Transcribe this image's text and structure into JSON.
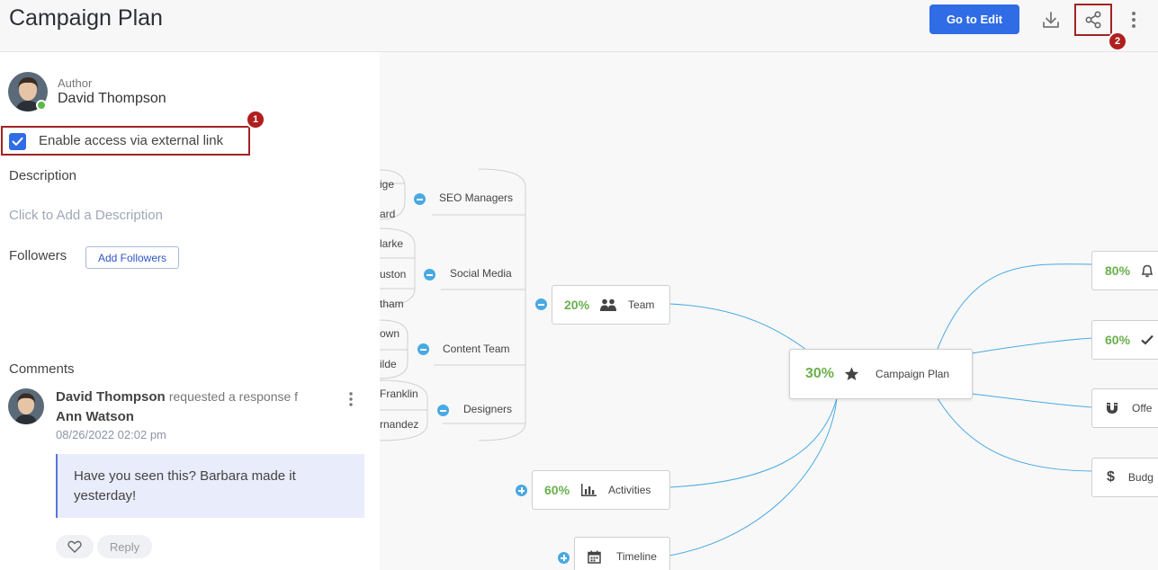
{
  "header": {
    "title": "Campaign Plan",
    "edit_button": "Go to Edit",
    "share_marker": "2"
  },
  "left": {
    "author_label": "Author",
    "author_name": "David Thompson",
    "access_label": "Enable access via external link",
    "access_checked": true,
    "access_marker": "1",
    "description_heading": "Description",
    "description_placeholder": "Click to Add a Description",
    "followers_heading": "Followers",
    "add_followers_button": "Add Followers",
    "comments_heading": "Comments",
    "comment": {
      "author": "David Thompson",
      "action": "requested a response f",
      "target": "Ann Watson",
      "date": "08/26/2022 02:02 pm",
      "text": "Have you seen this? Barbara made it yesterday!",
      "reply": "Reply"
    }
  },
  "map": {
    "central": {
      "percent": "30%",
      "label": "Campaign Plan"
    },
    "team": {
      "percent": "20%",
      "label": "Team"
    },
    "activities": {
      "percent": "60%",
      "label": "Activities"
    },
    "timeline": {
      "label": "Timeline"
    },
    "groups": {
      "seo": "SEO Managers",
      "social": "Social Media",
      "content": "Content Team",
      "designers": "Designers"
    },
    "members": [
      "ige",
      "ard",
      "larke",
      "uston",
      "tham",
      "own",
      "ilde",
      "Franklin",
      "rnandez"
    ],
    "right_nodes": [
      {
        "percent": "80%",
        "label": ""
      },
      {
        "percent": "60%",
        "label": ""
      },
      {
        "percent": "",
        "label": "Offe"
      },
      {
        "percent": "",
        "label": "Budg"
      }
    ],
    "line_color": "#49a9e2"
  },
  "colors": {
    "accent": "#2f6ce5",
    "marker": "#b01f1f",
    "percent_green": "#6ab04c"
  }
}
